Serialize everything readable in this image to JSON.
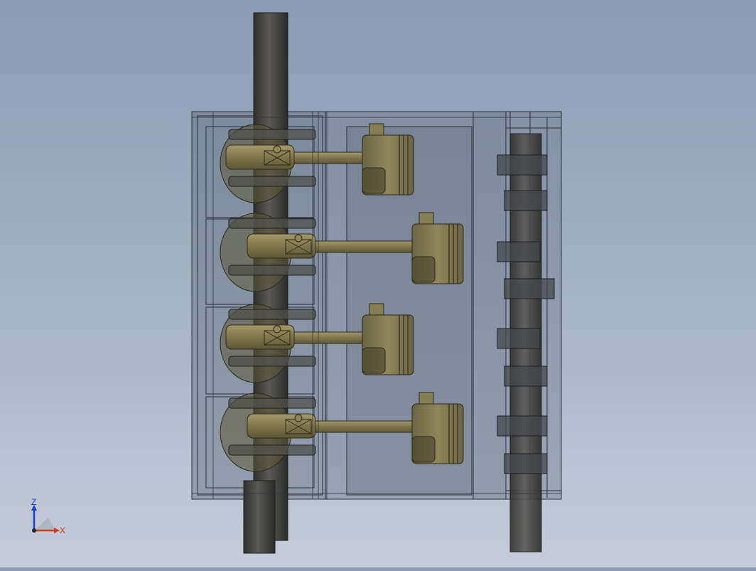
{
  "viewport": {
    "background_top": "#8a9bb3",
    "background_bottom": "#c6ccd8",
    "model": "four-cylinder-engine-assembly",
    "cylinder_count": 4,
    "camshaft_lobe_count": 8
  },
  "colors": {
    "housing_fill": "#6e7787",
    "housing_edge": "#2b2f36",
    "shaft_fill": "#4a4a48",
    "bronze": "#8f875a",
    "bronze_dark": "#5f5a3a"
  },
  "triad": {
    "z_label": "Z",
    "x_label": "X",
    "z_color": "#1a3bd6",
    "x_color": "#d63a1a",
    "origin_icon": "triad-origin-icon"
  }
}
